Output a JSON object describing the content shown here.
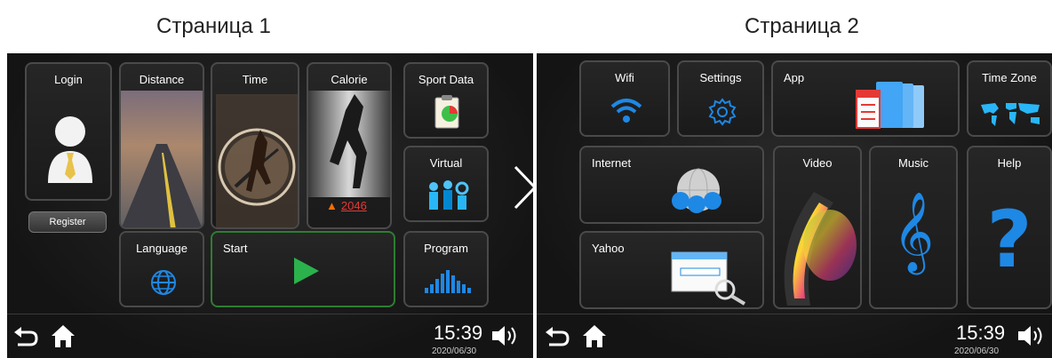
{
  "captions": {
    "page1": "Страница 1",
    "page2": "Страница 2"
  },
  "page1": {
    "tiles": {
      "login": "Login",
      "distance": "Distance",
      "time": "Time",
      "calorie": "Calorie",
      "calorie_value": "2046",
      "sport_data": "Sport Data",
      "virtual": "Virtual",
      "language": "Language",
      "start": "Start",
      "program": "Program"
    },
    "register_button": "Register",
    "clock": "15:39",
    "date": "2020/06/30"
  },
  "page2": {
    "tiles": {
      "wifi": "Wifi",
      "settings": "Settings",
      "app": "App",
      "time_zone": "Time Zone",
      "internet": "Internet",
      "video": "Video",
      "music": "Music",
      "help": "Help",
      "yahoo": "Yahoo"
    },
    "clock": "15:39",
    "date": "2020/06/30"
  },
  "colors": {
    "accent_blue": "#1e88e5",
    "start_green": "#2bb24c",
    "calorie_red": "#e53935"
  }
}
